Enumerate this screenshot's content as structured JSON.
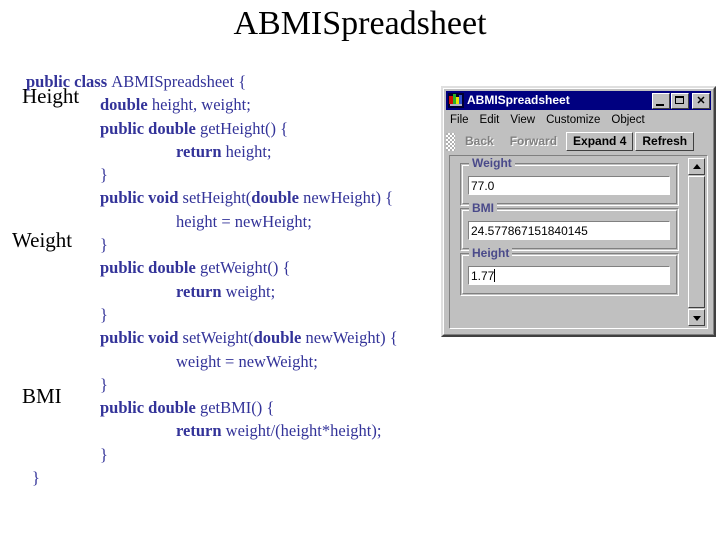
{
  "slide": {
    "title": "ABMISpreadsheet"
  },
  "outline_labels": [
    {
      "text": "Height"
    },
    {
      "text": "Weight"
    },
    {
      "text": "BMI"
    }
  ],
  "code": {
    "color": "#333399",
    "lines": [
      {
        "indent": 0,
        "segments": [
          {
            "t": "public class ",
            "bold": true
          },
          {
            "t": "ABMISpreadsheet {",
            "bold": false
          }
        ]
      },
      {
        "indent": 1,
        "segments": [
          {
            "t": "double ",
            "bold": true
          },
          {
            "t": "height, weight;",
            "bold": false
          }
        ]
      },
      {
        "indent": 1,
        "segments": [
          {
            "t": "public double ",
            "bold": true
          },
          {
            "t": "getHeight() {",
            "bold": false
          }
        ]
      },
      {
        "indent": 2,
        "segments": [
          {
            "t": "return ",
            "bold": true
          },
          {
            "t": "height;",
            "bold": false
          }
        ]
      },
      {
        "indent": 1,
        "segments": [
          {
            "t": "}",
            "bold": false
          }
        ]
      },
      {
        "indent": 1,
        "segments": [
          {
            "t": "public void ",
            "bold": true
          },
          {
            "t": "setHeight(",
            "bold": false
          },
          {
            "t": "double ",
            "bold": true
          },
          {
            "t": "newHeight) {",
            "bold": false
          }
        ]
      },
      {
        "indent": 2,
        "segments": [
          {
            "t": "height = newHeight;",
            "bold": false
          }
        ]
      },
      {
        "indent": 1,
        "segments": [
          {
            "t": "}",
            "bold": false
          }
        ]
      },
      {
        "indent": 1,
        "segments": [
          {
            "t": "public double ",
            "bold": true
          },
          {
            "t": "getWeight() {",
            "bold": false
          }
        ]
      },
      {
        "indent": 2,
        "segments": [
          {
            "t": "return ",
            "bold": true
          },
          {
            "t": "weight;",
            "bold": false
          }
        ]
      },
      {
        "indent": 1,
        "segments": [
          {
            "t": "}",
            "bold": false
          }
        ]
      },
      {
        "indent": 1,
        "segments": [
          {
            "t": "public void ",
            "bold": true
          },
          {
            "t": "setWeight(",
            "bold": false
          },
          {
            "t": "double ",
            "bold": true
          },
          {
            "t": "newWeight) {",
            "bold": false
          }
        ]
      },
      {
        "indent": 2,
        "segments": [
          {
            "t": "weight = newWeight;",
            "bold": false
          }
        ]
      },
      {
        "indent": 1,
        "segments": [
          {
            "t": "}",
            "bold": false
          }
        ]
      },
      {
        "indent": 1,
        "segments": [
          {
            "t": "public double ",
            "bold": true
          },
          {
            "t": "getBMI() {",
            "bold": false
          }
        ]
      },
      {
        "indent": 2,
        "segments": [
          {
            "t": "return ",
            "bold": true
          },
          {
            "t": "weight/(height*height);",
            "bold": false
          }
        ]
      },
      {
        "indent": 1,
        "segments": [
          {
            "t": "}",
            "bold": false
          }
        ]
      },
      {
        "indent": 3,
        "segments": [
          {
            "t": "}",
            "bold": false
          }
        ]
      }
    ]
  },
  "app_window": {
    "title": "ABMISpreadsheet",
    "icon": "java-app-icon",
    "title_bar_color": "#000080",
    "caption_buttons": [
      {
        "name": "minimize",
        "glyph": "minimize-icon"
      },
      {
        "name": "maximize",
        "glyph": "maximize-icon"
      },
      {
        "name": "close",
        "glyph": "✕"
      }
    ],
    "menu": [
      {
        "label": "File"
      },
      {
        "label": "Edit"
      },
      {
        "label": "View"
      },
      {
        "label": "Customize"
      },
      {
        "label": "Object"
      }
    ],
    "toolbar": [
      {
        "label": "Back",
        "enabled": false
      },
      {
        "label": "Forward",
        "enabled": false
      },
      {
        "label": "Expand 4",
        "enabled": true
      },
      {
        "label": "Refresh",
        "enabled": true
      }
    ],
    "fields": [
      {
        "label": "Weight",
        "value": "77.0",
        "focused": false
      },
      {
        "label": "BMI",
        "value": "24.577867151840145",
        "focused": false
      },
      {
        "label": "Height",
        "value": "1.77",
        "focused": true
      }
    ],
    "label_color": "#4a4a8a",
    "face_color": "#c0c0c0"
  }
}
